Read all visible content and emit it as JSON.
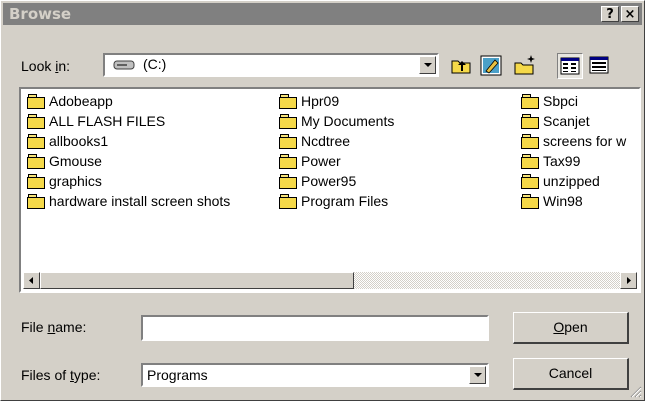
{
  "window": {
    "title": "Browse",
    "help_label": "?",
    "close_label": "×"
  },
  "look_in": {
    "label_pre": "Look ",
    "label_u": "i",
    "label_post": "n:",
    "value": "(C:)"
  },
  "toolbar": [
    {
      "name": "up-one-level-icon"
    },
    {
      "name": "desktop-icon"
    },
    {
      "name": "new-folder-icon"
    },
    {
      "name": "list-view-icon",
      "selected": true
    },
    {
      "name": "details-view-icon"
    }
  ],
  "files": {
    "col1": [
      "Adobeapp",
      "ALL FLASH FILES",
      "allbooks1",
      "Gmouse",
      "graphics",
      "hardware install screen shots"
    ],
    "col2": [
      "Hpr09",
      "My Documents",
      "Ncdtree",
      "Power",
      "Power95",
      "Program Files"
    ],
    "col3": [
      "Sbpci",
      "Scanjet",
      "screens for w",
      "Tax99",
      "unzipped",
      "Win98"
    ]
  },
  "file_name": {
    "label_pre": "File ",
    "label_u": "n",
    "label_post": "ame:",
    "value": ""
  },
  "file_type": {
    "label_pre": "Files of ",
    "label_u": "t",
    "label_post": "ype:",
    "value": "Programs"
  },
  "buttons": {
    "open_u": "O",
    "open_rest": "pen",
    "cancel": "Cancel"
  }
}
